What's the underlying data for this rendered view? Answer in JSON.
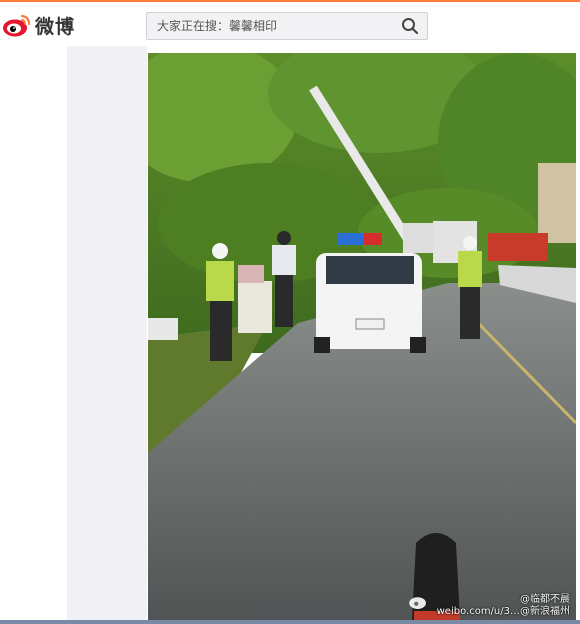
{
  "header": {
    "logo_text": "微博",
    "logo_icon": "weibo-eye-logo",
    "search": {
      "placeholder": "大家正在搜：馨馨相印",
      "icon": "search-icon"
    }
  },
  "post": {
    "image_alt": "",
    "watermark": {
      "line1": "@临都不晨",
      "line2": "weibo.com/u/3…@新浪福州"
    }
  },
  "colors": {
    "accent": "#fa7d3c",
    "panel": "#f0f0f5"
  }
}
